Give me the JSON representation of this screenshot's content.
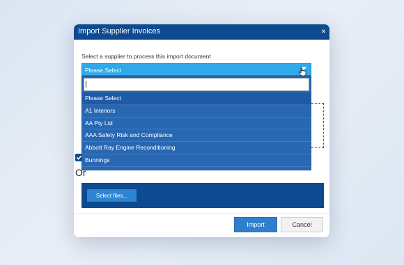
{
  "dialog": {
    "title": "Import Supplier Invoices",
    "close_icon": "×",
    "prompt": "Select a supplier to process this import document"
  },
  "supplier_select": {
    "selected": "Please Select",
    "search_value": "",
    "options": [
      "Please Select",
      "A1 Interiors",
      "AA Pty Ltd",
      "AAA Safety Risk and Compliance",
      "Abbott Ray Engine Reconditioning",
      "Bunnings"
    ],
    "highlighted_index": 0
  },
  "upload": {
    "or_label": "Or",
    "select_files_label": "Select files..."
  },
  "footer": {
    "import_label": "Import",
    "cancel_label": "Cancel"
  },
  "colors": {
    "title_bar": "#0d4a8f",
    "select_bg": "#2fa9e9",
    "dropdown_bg": "#2868b3",
    "import_btn": "#2f7fca"
  },
  "icons": [
    "close-icon",
    "chevron-down-icon",
    "hand-pointer-icon",
    "checkmark-icon"
  ]
}
